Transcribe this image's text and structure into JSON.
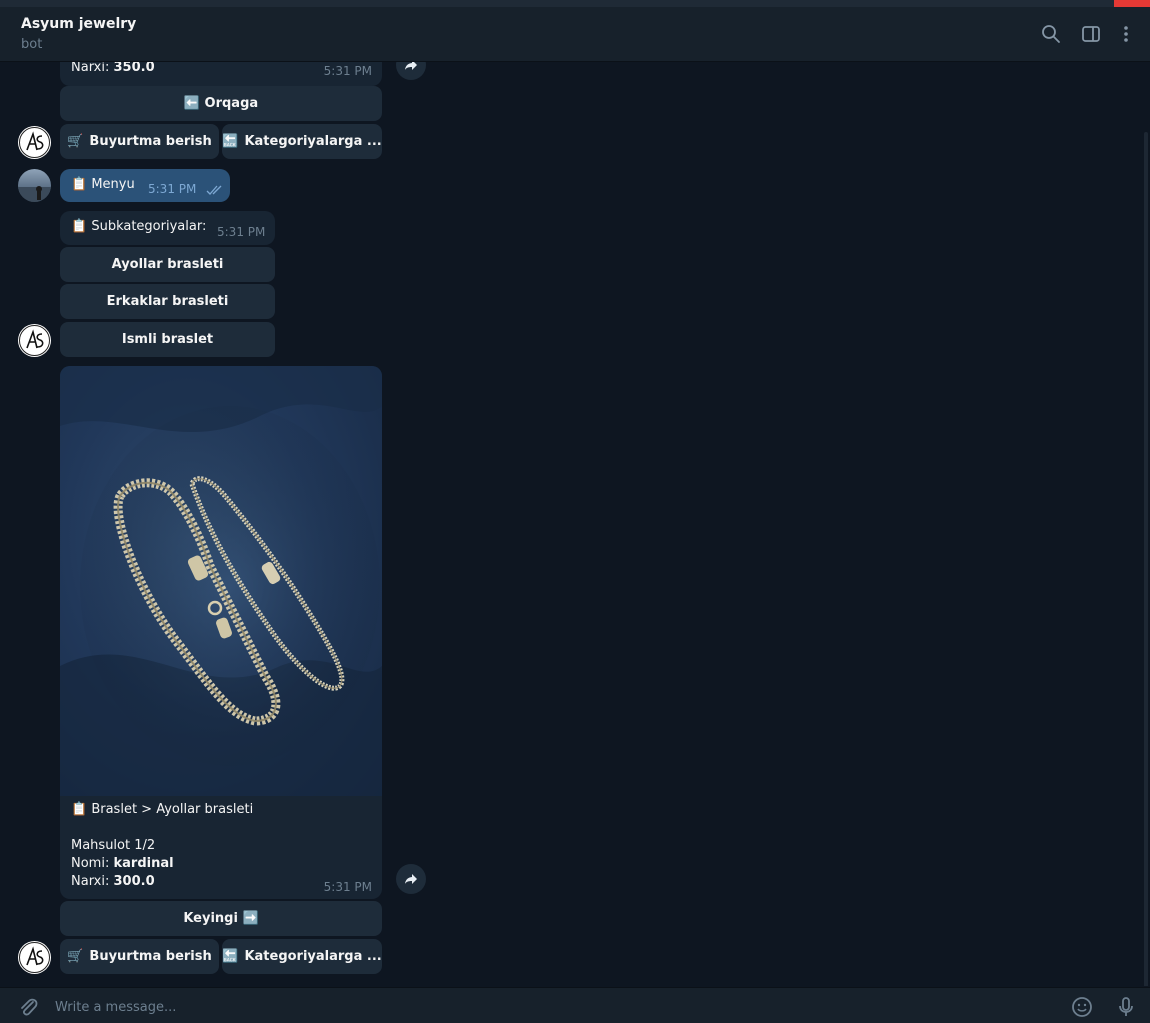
{
  "header": {
    "title": "Asyum jewelry",
    "subtitle": "bot"
  },
  "icons": {
    "search": "search-icon",
    "sidebar": "sidebar-toggle-icon",
    "menu": "more-vertical-icon",
    "attach": "paperclip-icon",
    "emoji": "emoji-icon",
    "mic": "microphone-icon",
    "forward": "forward-icon"
  },
  "messages": {
    "m1": {
      "price_label": "Narxi:",
      "price_value": "350.0",
      "time": "5:31 PM"
    },
    "kb1": {
      "back": "⬅️ Orqaga",
      "order": "Buyurtma berish",
      "order_emoji": "🛒",
      "categories": "Kategoriyalarga ...",
      "categories_emoji": "🔙"
    },
    "m2": {
      "emoji": "📋",
      "text": "Menyu",
      "time": "5:31 PM"
    },
    "m3": {
      "emoji": "📋",
      "text": "Subkategoriyalar:",
      "time": "5:31 PM"
    },
    "kb3": [
      "Ayollar brasleti",
      "Erkaklar brasleti",
      "Ismli braslet"
    ],
    "m4": {
      "emoji": "📋",
      "path": "Braslet > Ayollar brasleti",
      "product": "Mahsulot 1/2",
      "name_label": "Nomi:",
      "name_value": "kardinal",
      "price_label": "Narxi:",
      "price_value": "300.0",
      "time": "5:31 PM"
    },
    "kb4": {
      "next": "Keyingi ➡️",
      "order": "Buyurtma berish",
      "order_emoji": "🛒",
      "categories": "Kategoriyalarga ...",
      "categories_emoji": "🔙"
    }
  },
  "composer": {
    "placeholder": "Write a message..."
  },
  "colors": {
    "background": "#0e1621",
    "header": "#17212b",
    "incoming": "#182533",
    "outgoing": "#2b5278",
    "button": "#1e2c3a",
    "muted": "#6d7f8f",
    "close": "#e53935"
  }
}
